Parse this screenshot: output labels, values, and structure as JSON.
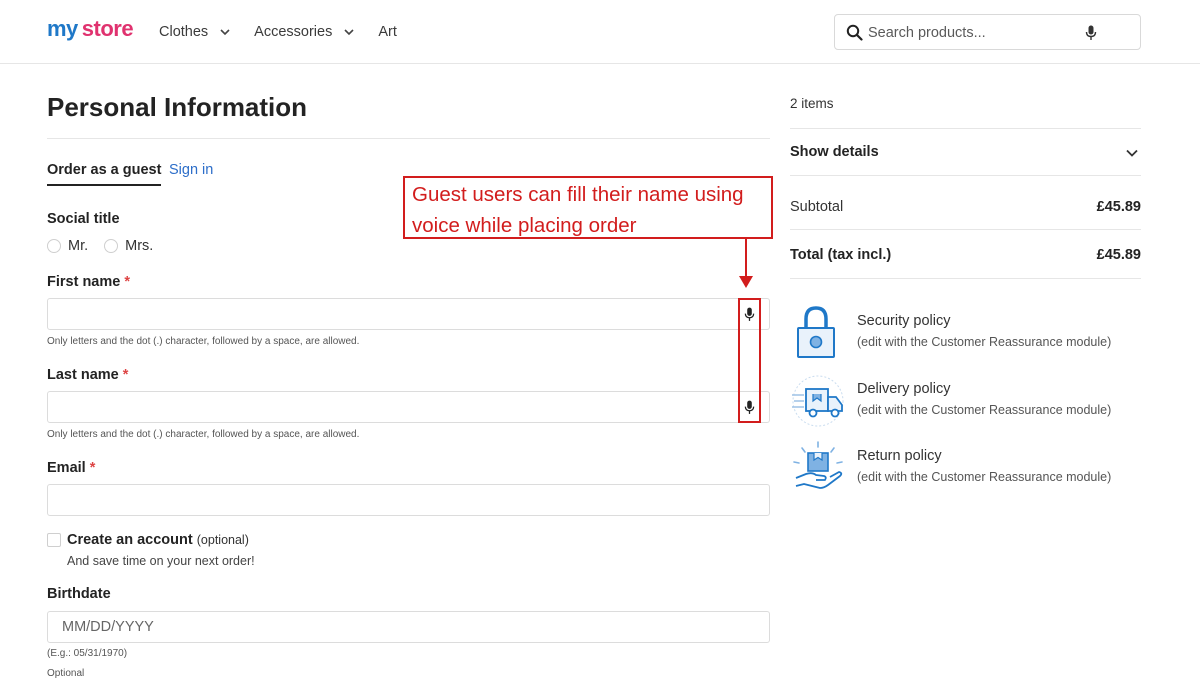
{
  "header": {
    "logo_text_1": "my",
    "logo_text_2": "store",
    "nav": [
      {
        "label": "Clothes",
        "has_dropdown": true
      },
      {
        "label": "Accessories",
        "has_dropdown": true
      },
      {
        "label": "Art",
        "has_dropdown": false
      }
    ],
    "search_placeholder": "Search products..."
  },
  "form": {
    "title": "Personal Information",
    "tab_guest": "Order as a guest",
    "tab_signin": "Sign in",
    "social_title_label": "Social title",
    "social_options": [
      "Mr.",
      "Mrs."
    ],
    "first_name_label": "First name",
    "last_name_label": "Last name",
    "email_label": "Email",
    "required_mark": "*",
    "name_hint": "Only letters and the dot (.) character, followed by a space, are allowed.",
    "create_account_label": "Create an account",
    "create_account_optional": "(optional)",
    "create_account_sub": "And save time on your next order!",
    "birthdate_label": "Birthdate",
    "birthdate_placeholder": "MM/DD/YYYY",
    "birthdate_example": "(E.g.: 05/31/1970)",
    "birthdate_optional": "Optional"
  },
  "annotation": {
    "text": "Guest users can fill their name using voice while placing order",
    "color": "#d21d1d"
  },
  "summary": {
    "items_count": "2 items",
    "show_details": "Show details",
    "subtotal_label": "Subtotal",
    "subtotal_value": "£45.89",
    "total_label": "Total (tax incl.)",
    "total_value": "£45.89"
  },
  "reassurance": [
    {
      "icon": "padlock-icon",
      "title": "Security policy",
      "subtitle": "(edit with the Customer Reassurance module)"
    },
    {
      "icon": "delivery-truck-icon",
      "title": "Delivery policy",
      "subtitle": "(edit with the Customer Reassurance module)"
    },
    {
      "icon": "return-box-hand-icon",
      "title": "Return policy",
      "subtitle": "(edit with the Customer Reassurance module)"
    }
  ],
  "colors": {
    "accent_blue": "#2d6ec9",
    "icon_blue": "#1f78c8",
    "logo_colors": [
      "#1f78c8",
      "#e0326f",
      "#f0a020",
      "#3db54a",
      "#7b4fc8"
    ]
  }
}
